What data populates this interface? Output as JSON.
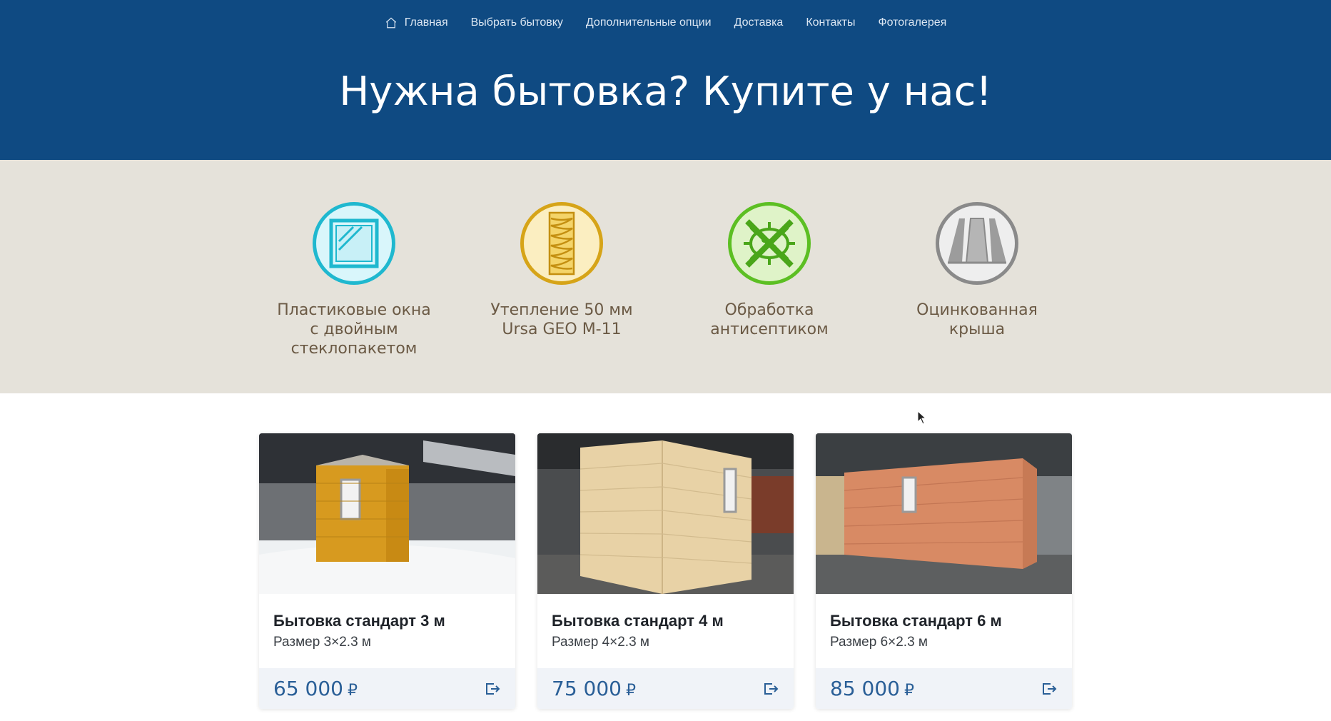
{
  "nav": {
    "items": [
      {
        "label": "Главная",
        "icon": "home-icon"
      },
      {
        "label": "Выбрать бытовку"
      },
      {
        "label": "Дополнительные опции"
      },
      {
        "label": "Доставка"
      },
      {
        "label": "Контакты"
      },
      {
        "label": "Фотогалерея"
      }
    ]
  },
  "hero": {
    "title": "Нужна бытовка? Купите у нас!"
  },
  "features": [
    {
      "label": "Пластиковые окна\nс двойным\nстеклопакетом",
      "icon": "window-icon",
      "color": "#1fb8cf"
    },
    {
      "label": "Утепление 50 мм\nUrsa GEO M-11",
      "icon": "insulation-icon",
      "color": "#d6a418"
    },
    {
      "label": "Обработка\nантисептиком",
      "icon": "antiseptic-icon",
      "color": "#5cbf23"
    },
    {
      "label": "Оцинкованная\nкрыша",
      "icon": "roof-icon",
      "color": "#8a8a8a"
    }
  ],
  "products": [
    {
      "title": "Бытовка стандарт 3 м",
      "size": "Размер 3×2.3 м",
      "price": "65 000",
      "currency": "₽",
      "wood_color": "#d79a1f"
    },
    {
      "title": "Бытовка стандарт 4 м",
      "size": "Размер 4×2.3 м",
      "price": "75 000",
      "currency": "₽",
      "wood_color": "#e8d2a6"
    },
    {
      "title": "Бытовка стандарт 6 м",
      "size": "Размер 6×2.3 м",
      "price": "85 000",
      "currency": "₽",
      "wood_color": "#d88a64"
    }
  ],
  "colors": {
    "header_bg": "#0f4a82",
    "features_bg": "#e5e2da",
    "price": "#2a5f97"
  }
}
